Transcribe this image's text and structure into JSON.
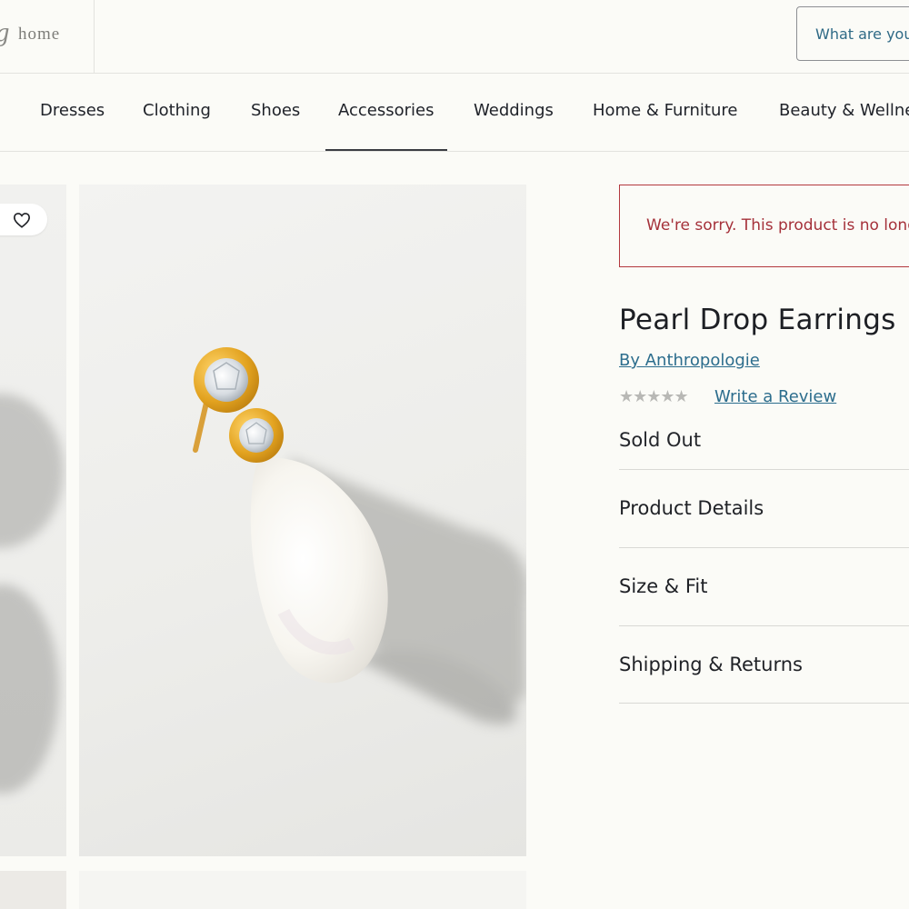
{
  "header": {
    "logo_script": "g",
    "logo_text": "home",
    "search_placeholder": "What are you searching for?"
  },
  "nav": {
    "items": [
      "Dresses",
      "Clothing",
      "Shoes",
      "Accessories",
      "Weddings",
      "Home & Furniture",
      "Beauty & Wellness"
    ],
    "active": "Accessories"
  },
  "gallery": {
    "favorite_icon": "heart-icon",
    "main_image_alt": "pearl-drop-earring-photo"
  },
  "product": {
    "alert": "We're sorry. This product is no longer available.",
    "title": "Pearl Drop Earrings",
    "brand": "By Anthropologie",
    "rating_stars": "★★★★★",
    "rating": 0,
    "review_link": "Write a Review",
    "stock_status": "Sold Out",
    "sections": [
      "Product Details",
      "Size & Fit",
      "Shipping & Returns"
    ]
  },
  "colors": {
    "link": "#2c6d8d",
    "alert": "#a5313a",
    "background": "#fbfbf7"
  }
}
